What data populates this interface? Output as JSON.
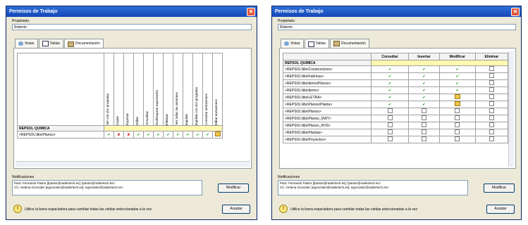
{
  "colors": {
    "title_bar": "#1447b8",
    "highlight_row": "#fff8b0",
    "check": "#2e9e2e",
    "cross": "#d62020"
  },
  "left": {
    "title": "Permisos de Trabajo",
    "propietario_label": "Propietario",
    "propietario_value": "Roberto",
    "tabs": [
      {
        "label": "Vistas",
        "icon": "views-icon"
      },
      {
        "label": "Tablas",
        "icon": "table-icon"
      },
      {
        "label": "Documentación",
        "icon": "documents-icon"
      }
    ],
    "active_tab": "Documentación",
    "columns": [
      "Ver con otro programa",
      "Copiar",
      "Exportar",
      "Editar",
      "Actualizar",
      "Desbloquear exportación",
      "Eliminar",
      "Ver todas las versiones",
      "Imprimir",
      "Imprimir con otro programa",
      "Consultar anotaciones",
      "Editar anotaciones"
    ],
    "group_row": "REPSOL QUIMICA",
    "row_label": "<REPSOL\\libs\\Planos>",
    "row_marks": [
      "check",
      "cross",
      "cross",
      "check",
      "check",
      "check",
      "check",
      "check",
      "check",
      "check",
      "check",
      "partial"
    ],
    "notif_label": "Notificaciones",
    "notif_lines": [
      "Para: Fernando Pastor [fpastor@radiertech.es]; fpastor@radiertech.es>",
      "CC: Helena Gonzalez [egonzalez@radiertech.es]; egonzalez@radiertech.es>"
    ],
    "modify_button": "Modificar",
    "hint": "Utilice la barra espaciadora para cambiar todas las celdas seleccionadas a la vez",
    "accept_button": "Aceptar"
  },
  "right": {
    "title": "Permisos de Trabajo",
    "propietario_label": "Propietario",
    "propietario_value": "Roberto",
    "tabs": [
      {
        "label": "Vistas",
        "icon": "views-icon"
      },
      {
        "label": "Tablas",
        "icon": "table-icon"
      },
      {
        "label": "Documentación",
        "icon": "documents-icon"
      }
    ],
    "active_tab": "Tablas",
    "columns": [
      "Consultar",
      "Insertar",
      "Modificar",
      "Eliminar"
    ],
    "group_row": "REPSOL QUIMICA",
    "rows": [
      {
        "label": "<REPSOL\\libs\\Constructores>",
        "marks": [
          "check",
          "check",
          "check",
          "empty"
        ]
      },
      {
        "label": "<REPSOL\\libs\\Fabricas>",
        "marks": [
          "check",
          "check",
          "check",
          "empty"
        ]
      },
      {
        "label": "<REPSOL\\libs\\Items\\Planos>",
        "marks": [
          "check",
          "check",
          "check",
          "empty"
        ]
      },
      {
        "label": "<REPSOL\\libs\\Items>",
        "marks": [
          "check",
          "check",
          "check",
          "empty"
        ]
      },
      {
        "label": "<REPSOL\\libs\\LETRA>",
        "marks": [
          "check",
          "check",
          "partial",
          "empty"
        ]
      },
      {
        "label": "<REPSOL\\libs\\Planos\\Planta>",
        "marks": [
          "check",
          "check",
          "partial",
          "empty"
        ]
      },
      {
        "label": "<REPSOL\\libs\\Planos>",
        "marks": [
          "empty",
          "empty",
          "empty",
          "empty"
        ]
      },
      {
        "label": "<REPSOL\\libs\\Planos_DWT>",
        "marks": [
          "empty",
          "empty",
          "empty",
          "empty"
        ]
      },
      {
        "label": "<REPSOL\\libs\\Planos_RVS>",
        "marks": [
          "empty",
          "empty",
          "empty",
          "empty"
        ]
      },
      {
        "label": "<REPSOL\\libs\\Plantas>",
        "marks": [
          "empty",
          "empty",
          "empty",
          "empty"
        ]
      },
      {
        "label": "<REPSOL\\libs\\Proyectos>",
        "marks": [
          "empty",
          "empty",
          "empty",
          "empty"
        ]
      }
    ],
    "notif_label": "Notificaciones",
    "notif_lines": [
      "Para: Fernando Pastor [fpastor@radiertech.es]; fpastor@radiertech.es>",
      "CC: Helena Gonzalez [egonzalez@radiertech.es]; egonzalez@radiertech.es>"
    ],
    "modify_button": "Modificar",
    "hint": "Utilice la barra espaciadora para cambiar todas las celdas seleccionadas a la vez",
    "accept_button": "Aceptar"
  }
}
